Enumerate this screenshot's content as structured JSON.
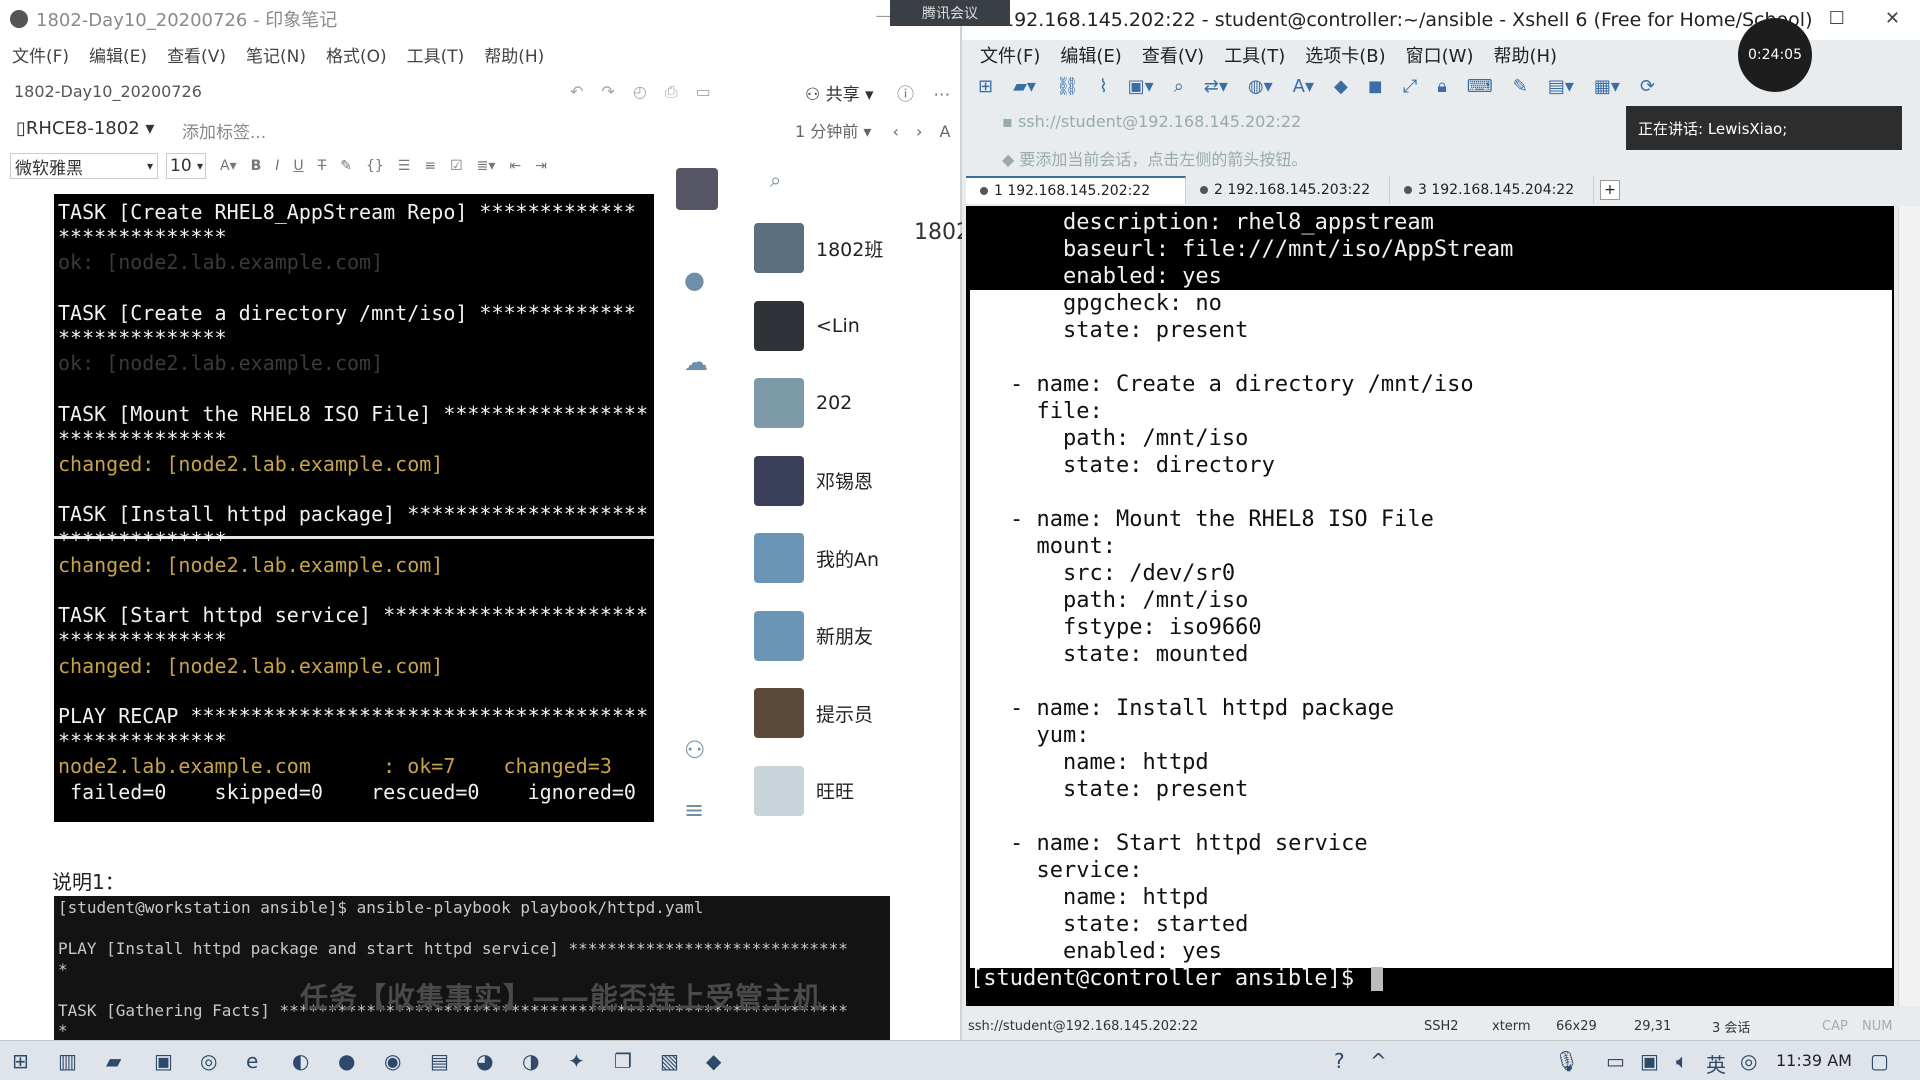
{
  "evernote": {
    "window_title": "1802-Day10_20200726 - 印象笔记",
    "menu": [
      "文件(F)",
      "编辑(E)",
      "查看(V)",
      "笔记(N)",
      "格式(O)",
      "工具(T)",
      "帮助(H)"
    ],
    "note_title": "1802-Day10_20200726",
    "share_label": "共享",
    "notebook": "RHCE8-1802",
    "add_tag": "添加标签...",
    "updated": "1 分钟前",
    "font_name": "微软雅黑",
    "font_size": "10",
    "caption": "说明1：",
    "subtitle": "任务【收集事实】——能否连上受管主机"
  },
  "terminal1": [
    {
      "text": "TASK [Create RHEL8_AppStream Repo] *************",
      "c": "w"
    },
    {
      "text": "**************",
      "c": "w"
    },
    {
      "text": "ok: [node2.lab.example.com]",
      "c": "dim"
    },
    {
      "text": "",
      "c": "w"
    },
    {
      "text": "TASK [Create a directory /mnt/iso] *************",
      "c": "w"
    },
    {
      "text": "**************",
      "c": "w"
    },
    {
      "text": "ok: [node2.lab.example.com]",
      "c": "dim"
    },
    {
      "text": "",
      "c": "w"
    },
    {
      "text": "TASK [Mount the RHEL8 ISO File] *****************",
      "c": "w"
    },
    {
      "text": "**************",
      "c": "w"
    },
    {
      "text": "changed: [node2.lab.example.com]",
      "c": "yel"
    },
    {
      "text": "",
      "c": "w"
    },
    {
      "text": "TASK [Install httpd package] ********************",
      "c": "w"
    },
    {
      "text": "**************",
      "c": "w"
    },
    {
      "text": "changed: [node2.lab.example.com]",
      "c": "yel"
    },
    {
      "text": "",
      "c": "w"
    },
    {
      "text": "TASK [Start httpd service] **********************",
      "c": "w"
    },
    {
      "text": "**************",
      "c": "w"
    },
    {
      "text": "changed: [node2.lab.example.com]",
      "c": "yel"
    },
    {
      "text": "",
      "c": "w"
    },
    {
      "text": "PLAY RECAP **************************************",
      "c": "w"
    },
    {
      "text": "**************",
      "c": "w"
    },
    {
      "text": "node2.lab.example.com      : ok=7    changed=3",
      "c": "yel"
    },
    {
      "text": " failed=0    skipped=0    rescued=0    ignored=0",
      "c": "w"
    }
  ],
  "terminal2": [
    "[student@workstation ansible]$ ansible-playbook playbook/httpd.yaml",
    "",
    "PLAY [Install httpd package and start httpd service] *****************************",
    "*",
    "",
    "TASK [Gathering Facts] ***********************************************************",
    "*"
  ],
  "chats": [
    {
      "name": "1802班",
      "color": "#5b6f7f"
    },
    {
      "name": "<Lin",
      "color": "#2f3338"
    },
    {
      "name": "202",
      "color": "#7c9aa8"
    },
    {
      "name": "邓锡恩",
      "color": "#3a3f5a"
    },
    {
      "name": "我的An",
      "color": "#6b95b5"
    },
    {
      "name": "新朋友",
      "color": "#6b95b5"
    },
    {
      "name": "提示员",
      "color": "#5b4a3a"
    },
    {
      "name": "旺旺",
      "color": "#c9d3da"
    }
  ],
  "chat_header": "1802",
  "xshell": {
    "window_title": "192.168.145.202:22 - student@controller:~/ansible - Xshell 6 (Free for Home/School)",
    "meeting_label": "腾讯会议",
    "menu": [
      "文件(F)",
      "编辑(E)",
      "查看(V)",
      "工具(T)",
      "选项卡(B)",
      "窗口(W)",
      "帮助(H)"
    ],
    "address": "ssh://student@192.168.145.202:22",
    "hint": "要添加当前会话，点击左侧的箭头按钮。",
    "speaking": "正在讲话: LewisXiao;",
    "clock": "0:24:05",
    "tabs": [
      "1 192.168.145.202:22",
      "2 192.168.145.203:22",
      "3 192.168.145.204:22"
    ],
    "lines": [
      {
        "text": "    description: rhel8_appstream",
        "c": "w"
      },
      {
        "text": "    baseurl: file:///mnt/iso/AppStream",
        "c": "w"
      },
      {
        "text": "    enabled: yes",
        "c": "w"
      },
      {
        "text": "    gpgcheck: no",
        "c": "b"
      },
      {
        "text": "    state: present",
        "c": "b"
      },
      {
        "text": "",
        "c": "b"
      },
      {
        "text": "- name: Create a directory /mnt/iso",
        "c": "b"
      },
      {
        "text": "  file:",
        "c": "b"
      },
      {
        "text": "    path: /mnt/iso",
        "c": "b"
      },
      {
        "text": "    state: directory",
        "c": "b"
      },
      {
        "text": "",
        "c": "b"
      },
      {
        "text": "- name: Mount the RHEL8 ISO File",
        "c": "b"
      },
      {
        "text": "  mount:",
        "c": "b"
      },
      {
        "text": "    src: /dev/sr0",
        "c": "b"
      },
      {
        "text": "    path: /mnt/iso",
        "c": "b"
      },
      {
        "text": "    fstype: iso9660",
        "c": "b"
      },
      {
        "text": "    state: mounted",
        "c": "b"
      },
      {
        "text": "",
        "c": "b"
      },
      {
        "text": "- name: Install httpd package",
        "c": "b"
      },
      {
        "text": "  yum:",
        "c": "b"
      },
      {
        "text": "    name: httpd",
        "c": "b"
      },
      {
        "text": "    state: present",
        "c": "b"
      },
      {
        "text": "",
        "c": "b"
      },
      {
        "text": "- name: Start httpd service",
        "c": "b"
      },
      {
        "text": "  service:",
        "c": "b"
      },
      {
        "text": "    name: httpd",
        "c": "b"
      },
      {
        "text": "    state: started",
        "c": "b"
      },
      {
        "text": "    enabled: yes",
        "c": "b"
      }
    ],
    "prompt": "[student@controller ansible]$ ",
    "status": {
      "conn": "ssh://student@192.168.145.202:22",
      "proto": "SSH2",
      "term": "xterm",
      "size": "66x29",
      "pos": "29,31",
      "sessions": "3 会话",
      "cap": "CAP",
      "num": "NUM"
    }
  },
  "taskbar": {
    "time": "11:39 AM"
  }
}
